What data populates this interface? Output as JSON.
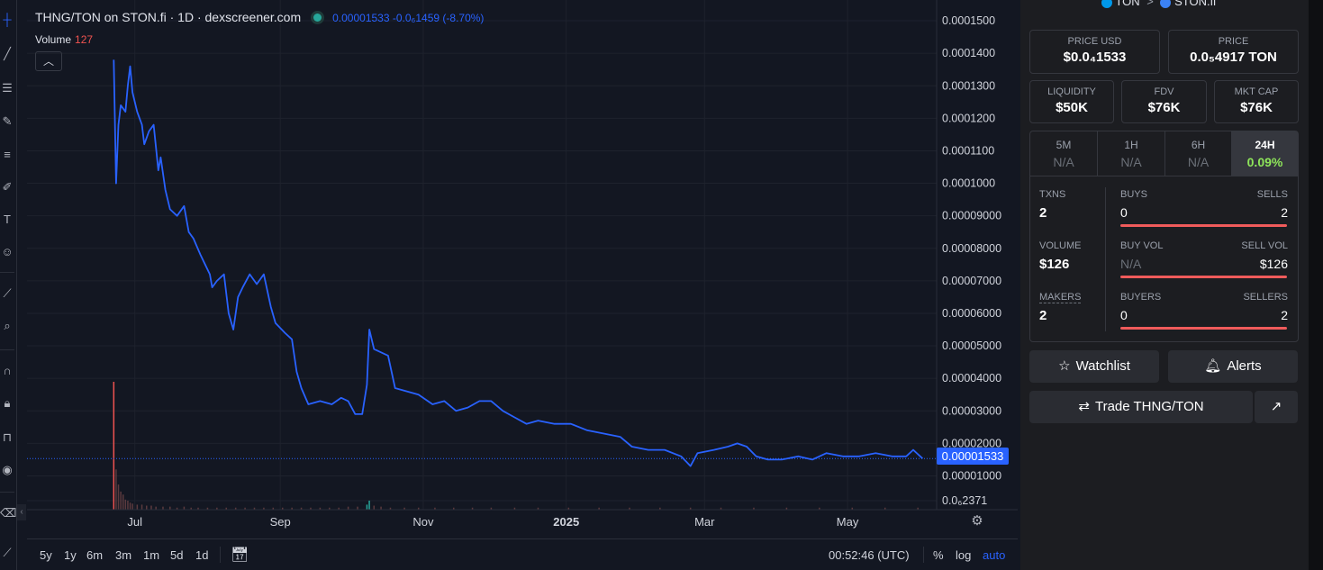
{
  "chart_header": {
    "title": "THNG/TON on STON.fi · 1D · dexscreener.com",
    "price_change": "0.00001533  -0.0₆1459 (-8.70%)",
    "volume_label": "Volume",
    "volume_value": "127",
    "collapse_icon": "chevron-up-icon"
  },
  "price_tag": "0.00001533",
  "timeframes": [
    "5y",
    "1y",
    "6m",
    "3m",
    "1m",
    "5d",
    "1d"
  ],
  "bottom_bar": {
    "time": "00:52:46 (UTC)",
    "percent": "%",
    "log": "log",
    "auto": "auto"
  },
  "pair_header": {
    "base": "TON",
    "arrow": ">",
    "dex": "STON.fi"
  },
  "price_usd": {
    "label": "PRICE USD",
    "value": "$0.0₄1533"
  },
  "price_ton": {
    "label": "PRICE",
    "value": "0.0₅4917 TON"
  },
  "liquidity": {
    "label": "LIQUIDITY",
    "value": "$50K"
  },
  "fdv": {
    "label": "FDV",
    "value": "$76K"
  },
  "mkt_cap": {
    "label": "MKT CAP",
    "value": "$76K"
  },
  "periods": [
    {
      "label": "5M",
      "value": "N/A"
    },
    {
      "label": "1H",
      "value": "N/A"
    },
    {
      "label": "6H",
      "value": "N/A"
    },
    {
      "label": "24H",
      "value": "0.09%"
    }
  ],
  "stats": {
    "txns": {
      "label": "TXNS",
      "value": "2"
    },
    "buys": {
      "label": "BUYS",
      "value": "0"
    },
    "sells": {
      "label": "SELLS",
      "value": "2"
    },
    "volume": {
      "label": "VOLUME",
      "value": "$126"
    },
    "buy_vol": {
      "label": "BUY VOL",
      "value": "N/A"
    },
    "sell_vol": {
      "label": "SELL VOL",
      "value": "$126"
    },
    "makers": {
      "label": "MAKERS",
      "value": "2"
    },
    "buyers": {
      "label": "BUYERS",
      "value": "0"
    },
    "sellers": {
      "label": "SELLERS",
      "value": "2"
    }
  },
  "buttons": {
    "watchlist": "Watchlist",
    "alerts": "Alerts",
    "trade": "Trade THNG/TON"
  },
  "colors": {
    "line": "#2962ff",
    "accent_green": "#8ee55a",
    "sell_red": "#f05b5b",
    "volume_red": "#ef5350",
    "volume_green": "#26a69a"
  },
  "chart_data": {
    "type": "line",
    "y_scale": "linear",
    "ylim": [
      2.37e-06,
      0.00015
    ],
    "y_ticks": [
      "0.0001500",
      "0.0001400",
      "0.0001300",
      "0.0001200",
      "0.0001100",
      "0.0001000",
      "0.00009000",
      "0.00008000",
      "0.00007000",
      "0.00006000",
      "0.00005000",
      "0.00004000",
      "0.00003000",
      "0.00002000",
      "0.00001000",
      "0.0₆2371"
    ],
    "y_tick_values": [
      0.00015,
      0.00014,
      0.00013,
      0.00012,
      0.00011,
      0.0001,
      9e-05,
      8e-05,
      7e-05,
      6e-05,
      5e-05,
      4e-05,
      3e-05,
      2e-05,
      1e-05,
      2.371e-06
    ],
    "x_ticks": [
      "Jul",
      "Sep",
      "Nov",
      "2025",
      "Mar",
      "May"
    ],
    "x_tick_dates": [
      "2024-07-01",
      "2024-09-01",
      "2024-11-01",
      "2025-01-01",
      "2025-03-01",
      "2025-05-01"
    ],
    "xlim": [
      "2024-05-16",
      "2025-06-08"
    ],
    "grid": true,
    "series": [
      {
        "values": [
          [
            "2024-06-22",
            0.000138
          ],
          [
            "2024-06-23",
            0.0001
          ],
          [
            "2024-06-24",
            0.000118
          ],
          [
            "2024-06-25",
            0.000124
          ],
          [
            "2024-06-27",
            0.000122
          ],
          [
            "2024-06-28",
            0.00013
          ],
          [
            "2024-06-29",
            0.000136
          ],
          [
            "2024-06-30",
            0.000128
          ],
          [
            "2024-07-02",
            0.000122
          ],
          [
            "2024-07-04",
            0.000118
          ],
          [
            "2024-07-05",
            0.000112
          ],
          [
            "2024-07-07",
            0.000116
          ],
          [
            "2024-07-09",
            0.000118
          ],
          [
            "2024-07-11",
            0.000104
          ],
          [
            "2024-07-12",
            0.000108
          ],
          [
            "2024-07-14",
            9.8e-05
          ],
          [
            "2024-07-16",
            9.2e-05
          ],
          [
            "2024-07-19",
            9e-05
          ],
          [
            "2024-07-22",
            9.3e-05
          ],
          [
            "2024-07-24",
            8.5e-05
          ],
          [
            "2024-07-26",
            8.3e-05
          ],
          [
            "2024-07-29",
            7.8e-05
          ],
          [
            "2024-07-31",
            7.5e-05
          ],
          [
            "2024-08-02",
            7.2e-05
          ],
          [
            "2024-08-03",
            6.8e-05
          ],
          [
            "2024-08-05",
            7e-05
          ],
          [
            "2024-08-08",
            7.2e-05
          ],
          [
            "2024-08-10",
            6e-05
          ],
          [
            "2024-08-12",
            5.5e-05
          ],
          [
            "2024-08-14",
            6.5e-05
          ],
          [
            "2024-08-16",
            6.8e-05
          ],
          [
            "2024-08-19",
            7.2e-05
          ],
          [
            "2024-08-22",
            6.9e-05
          ],
          [
            "2024-08-25",
            7.2e-05
          ],
          [
            "2024-08-28",
            6.2e-05
          ],
          [
            "2024-08-30",
            5.7e-05
          ],
          [
            "2024-09-03",
            5.4e-05
          ],
          [
            "2024-09-06",
            5.2e-05
          ],
          [
            "2024-09-08",
            4.2e-05
          ],
          [
            "2024-09-10",
            3.7e-05
          ],
          [
            "2024-09-13",
            3.2e-05
          ],
          [
            "2024-09-18",
            3.3e-05
          ],
          [
            "2024-09-23",
            3.2e-05
          ],
          [
            "2024-09-27",
            3.4e-05
          ],
          [
            "2024-09-30",
            3.3e-05
          ],
          [
            "2024-10-03",
            2.9e-05
          ],
          [
            "2024-10-06",
            2.9e-05
          ],
          [
            "2024-10-08",
            3.8e-05
          ],
          [
            "2024-10-09",
            5.5e-05
          ],
          [
            "2024-10-11",
            4.9e-05
          ],
          [
            "2024-10-14",
            4.8e-05
          ],
          [
            "2024-10-17",
            4.7e-05
          ],
          [
            "2024-10-20",
            3.7e-05
          ],
          [
            "2024-10-25",
            3.6e-05
          ],
          [
            "2024-10-30",
            3.5e-05
          ],
          [
            "2024-11-05",
            3.2e-05
          ],
          [
            "2024-11-10",
            3.3e-05
          ],
          [
            "2024-11-15",
            3e-05
          ],
          [
            "2024-11-20",
            3.1e-05
          ],
          [
            "2024-11-25",
            3.3e-05
          ],
          [
            "2024-11-30",
            3.3e-05
          ],
          [
            "2024-12-05",
            3e-05
          ],
          [
            "2024-12-10",
            2.8e-05
          ],
          [
            "2024-12-15",
            2.6e-05
          ],
          [
            "2024-12-20",
            2.7e-05
          ],
          [
            "2024-12-27",
            2.6e-05
          ],
          [
            "2025-01-03",
            2.6e-05
          ],
          [
            "2025-01-10",
            2.4e-05
          ],
          [
            "2025-01-17",
            2.3e-05
          ],
          [
            "2025-01-24",
            2.2e-05
          ],
          [
            "2025-01-29",
            1.9e-05
          ],
          [
            "2025-02-05",
            1.8e-05
          ],
          [
            "2025-02-12",
            1.8e-05
          ],
          [
            "2025-02-19",
            1.6e-05
          ],
          [
            "2025-02-23",
            1.3e-05
          ],
          [
            "2025-02-26",
            1.7e-05
          ],
          [
            "2025-03-05",
            1.8e-05
          ],
          [
            "2025-03-11",
            1.9e-05
          ],
          [
            "2025-03-15",
            2e-05
          ],
          [
            "2025-03-19",
            1.9e-05
          ],
          [
            "2025-03-23",
            1.6e-05
          ],
          [
            "2025-03-28",
            1.5e-05
          ],
          [
            "2025-04-03",
            1.5e-05
          ],
          [
            "2025-04-10",
            1.6e-05
          ],
          [
            "2025-04-16",
            1.5e-05
          ],
          [
            "2025-04-22",
            1.7e-05
          ],
          [
            "2025-04-29",
            1.6e-05
          ],
          [
            "2025-05-06",
            1.6e-05
          ],
          [
            "2025-05-13",
            1.7e-05
          ],
          [
            "2025-05-20",
            1.6e-05
          ],
          [
            "2025-05-26",
            1.6e-05
          ],
          [
            "2025-05-29",
            1.8e-05
          ],
          [
            "2025-06-01",
            1.6e-05
          ],
          [
            "2025-06-02",
            1.533e-05
          ]
        ]
      }
    ],
    "volume_bars": [
      [
        "2024-06-22",
        127
      ],
      [
        "2024-06-23",
        40
      ],
      [
        "2024-06-24",
        25
      ],
      [
        "2024-06-25",
        18
      ],
      [
        "2024-06-26",
        15
      ],
      [
        "2024-06-27",
        10
      ],
      [
        "2024-06-28",
        9
      ],
      [
        "2024-06-29",
        7
      ],
      [
        "2024-06-30",
        6
      ],
      [
        "2024-07-02",
        5
      ],
      [
        "2024-07-04",
        5
      ],
      [
        "2024-07-06",
        4
      ],
      [
        "2024-07-08",
        4
      ],
      [
        "2024-07-10",
        3
      ],
      [
        "2024-07-13",
        3
      ],
      [
        "2024-07-16",
        3
      ],
      [
        "2024-07-19",
        2
      ],
      [
        "2024-07-22",
        3
      ],
      [
        "2024-07-25",
        2
      ],
      [
        "2024-07-28",
        2
      ],
      [
        "2024-08-01",
        2
      ],
      [
        "2024-08-05",
        2
      ],
      [
        "2024-08-09",
        2
      ],
      [
        "2024-08-13",
        2
      ],
      [
        "2024-08-17",
        2
      ],
      [
        "2024-08-21",
        2
      ],
      [
        "2024-08-25",
        2
      ],
      [
        "2024-08-29",
        2
      ],
      [
        "2024-09-02",
        2
      ],
      [
        "2024-09-06",
        2
      ],
      [
        "2024-09-10",
        2
      ],
      [
        "2024-09-14",
        2
      ],
      [
        "2024-09-18",
        2
      ],
      [
        "2024-09-22",
        2
      ],
      [
        "2024-09-26",
        2
      ],
      [
        "2024-09-30",
        3
      ],
      [
        "2024-10-04",
        3
      ],
      [
        "2024-10-08",
        5
      ],
      [
        "2024-10-09",
        9
      ],
      [
        "2024-10-11",
        4
      ],
      [
        "2024-10-14",
        3
      ],
      [
        "2024-10-18",
        2
      ],
      [
        "2024-10-24",
        2
      ],
      [
        "2024-10-30",
        2
      ],
      [
        "2024-11-06",
        2
      ],
      [
        "2024-11-14",
        2
      ],
      [
        "2024-11-22",
        2
      ],
      [
        "2024-11-30",
        2
      ],
      [
        "2024-12-10",
        2
      ],
      [
        "2024-12-20",
        2
      ],
      [
        "2025-01-02",
        2
      ],
      [
        "2025-01-15",
        2
      ],
      [
        "2025-01-28",
        2
      ],
      [
        "2025-02-10",
        2
      ],
      [
        "2025-02-23",
        2
      ],
      [
        "2025-03-08",
        2
      ],
      [
        "2025-03-22",
        2
      ],
      [
        "2025-04-05",
        2
      ],
      [
        "2025-04-19",
        2
      ],
      [
        "2025-05-03",
        2
      ],
      [
        "2025-05-17",
        2
      ],
      [
        "2025-05-31",
        2
      ]
    ]
  }
}
